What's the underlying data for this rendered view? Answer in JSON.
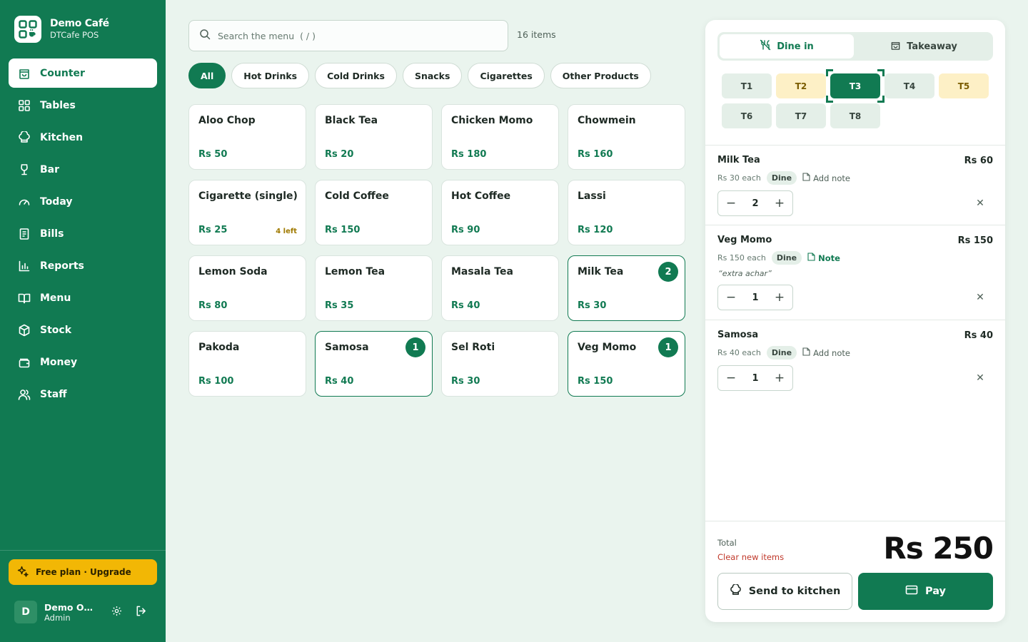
{
  "brand": {
    "name": "Demo Café",
    "subtitle": "DTCafe POS"
  },
  "nav": [
    {
      "label": "Counter",
      "icon": "shopping-bag-icon",
      "active": true
    },
    {
      "label": "Tables",
      "icon": "grid-icon"
    },
    {
      "label": "Kitchen",
      "icon": "chef-hat-icon"
    },
    {
      "label": "Bar",
      "icon": "wine-glass-icon"
    },
    {
      "label": "Today",
      "icon": "gauge-icon"
    },
    {
      "label": "Bills",
      "icon": "receipt-icon"
    },
    {
      "label": "Reports",
      "icon": "bar-chart-icon"
    },
    {
      "label": "Menu",
      "icon": "book-icon"
    },
    {
      "label": "Stock",
      "icon": "box-icon"
    },
    {
      "label": "Money",
      "icon": "wallet-icon"
    },
    {
      "label": "Staff",
      "icon": "users-icon"
    }
  ],
  "upgrade": {
    "label": "Free plan · Upgrade"
  },
  "user": {
    "initial": "D",
    "name": "Demo Ow...",
    "role": "Admin"
  },
  "search": {
    "placeholder": "Search the menu  ( / )",
    "value": ""
  },
  "items_count": "16 items",
  "categories": [
    {
      "label": "All",
      "active": true
    },
    {
      "label": "Hot Drinks"
    },
    {
      "label": "Cold Drinks"
    },
    {
      "label": "Snacks"
    },
    {
      "label": "Cigarettes"
    },
    {
      "label": "Other Products"
    }
  ],
  "menu_items": [
    {
      "name": "Aloo Chop",
      "price": "Rs 50"
    },
    {
      "name": "Black Tea",
      "price": "Rs 20"
    },
    {
      "name": "Chicken Momo",
      "price": "Rs 180"
    },
    {
      "name": "Chowmein",
      "price": "Rs 160"
    },
    {
      "name": "Cigarette (single)",
      "price": "Rs 25",
      "stock": "4 left"
    },
    {
      "name": "Cold Coffee",
      "price": "Rs 150"
    },
    {
      "name": "Hot Coffee",
      "price": "Rs 90"
    },
    {
      "name": "Lassi",
      "price": "Rs 120"
    },
    {
      "name": "Lemon Soda",
      "price": "Rs 80"
    },
    {
      "name": "Lemon Tea",
      "price": "Rs 35"
    },
    {
      "name": "Masala Tea",
      "price": "Rs 40"
    },
    {
      "name": "Milk Tea",
      "price": "Rs 30",
      "qty": "2"
    },
    {
      "name": "Pakoda",
      "price": "Rs 100"
    },
    {
      "name": "Samosa",
      "price": "Rs 40",
      "qty": "1"
    },
    {
      "name": "Sel Roti",
      "price": "Rs 30"
    },
    {
      "name": "Veg Momo",
      "price": "Rs 150",
      "qty": "1"
    }
  ],
  "order": {
    "modes": [
      {
        "label": "Dine in",
        "icon": "utensils-off-icon",
        "active": true
      },
      {
        "label": "Takeaway",
        "icon": "bag-icon"
      }
    ],
    "tables": [
      {
        "label": "T1",
        "state": "free"
      },
      {
        "label": "T2",
        "state": "busy"
      },
      {
        "label": "T3",
        "state": "active"
      },
      {
        "label": "T4",
        "state": "free"
      },
      {
        "label": "T5",
        "state": "busy"
      },
      {
        "label": "T6",
        "state": "free"
      },
      {
        "label": "T7",
        "state": "free"
      },
      {
        "label": "T8",
        "state": "free"
      }
    ],
    "lines": [
      {
        "name": "Milk Tea",
        "each": "Rs 30 each",
        "tag": "Dine",
        "note_action": "Add note",
        "note": "",
        "qty": "2",
        "total": "Rs 60"
      },
      {
        "name": "Veg Momo",
        "each": "Rs 150 each",
        "tag": "Dine",
        "note_action": "Note",
        "note": "“extra achar”",
        "qty": "1",
        "total": "Rs 150"
      },
      {
        "name": "Samosa",
        "each": "Rs 40 each",
        "tag": "Dine",
        "note_action": "Add note",
        "note": "",
        "qty": "1",
        "total": "Rs 40"
      }
    ],
    "total_label": "Total",
    "clear_label": "Clear new items",
    "total": "Rs 250",
    "send_label": "Send to kitchen",
    "pay_label": "Pay"
  },
  "colors": {
    "primary": "#117a52",
    "accent": "#f2b705",
    "busy": "#fdf0c6",
    "danger": "#c0392b"
  }
}
